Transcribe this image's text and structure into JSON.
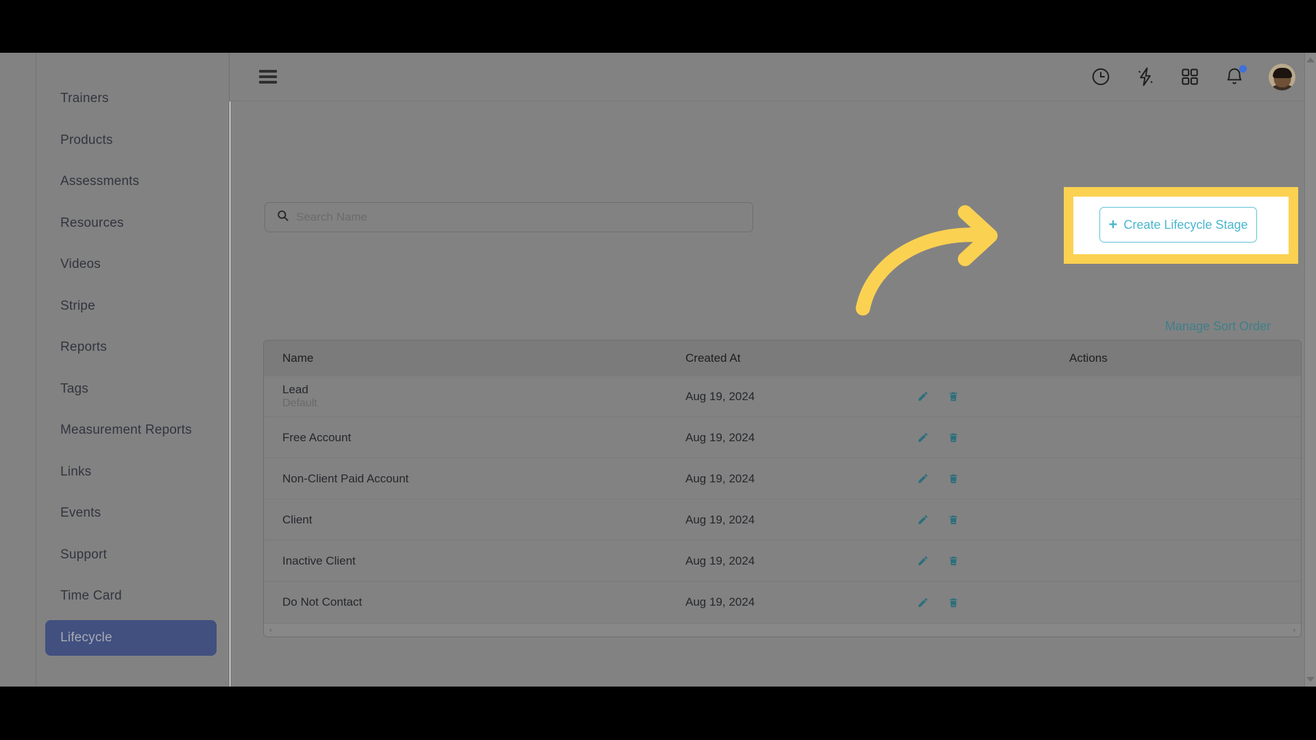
{
  "app": {
    "accent_teal": "#2b6f7c",
    "accent_cyan": "#49b6cd",
    "accent_indigo": "#41507f",
    "highlight_yellow": "#fbd152",
    "badge_blue": "#3f6fd8"
  },
  "sidebar": {
    "items": [
      {
        "label": "Trainers",
        "active": false
      },
      {
        "label": "Products",
        "active": false
      },
      {
        "label": "Assessments",
        "active": false
      },
      {
        "label": "Resources",
        "active": false
      },
      {
        "label": "Videos",
        "active": false
      },
      {
        "label": "Stripe",
        "active": false
      },
      {
        "label": "Reports",
        "active": false
      },
      {
        "label": "Tags",
        "active": false
      },
      {
        "label": "Measurement Reports",
        "active": false
      },
      {
        "label": "Links",
        "active": false
      },
      {
        "label": "Events",
        "active": false
      },
      {
        "label": "Support",
        "active": false
      },
      {
        "label": "Time Card",
        "active": false
      },
      {
        "label": "Lifecycle",
        "active": true
      }
    ]
  },
  "topbar": {
    "menu_icon": "hamburger-icon",
    "icons": [
      {
        "name": "clock-icon"
      },
      {
        "name": "lightning-bolt-icon"
      },
      {
        "name": "apps-grid-icon"
      },
      {
        "name": "bell-icon",
        "badge": true
      }
    ],
    "avatar_alt": "user-avatar"
  },
  "search": {
    "icon": "search-icon",
    "value": "",
    "placeholder": "Search Name"
  },
  "actions": {
    "manage_sort_order": "Manage Sort Order",
    "create_button": {
      "plus": "+",
      "label": "Create Lifecycle Stage"
    }
  },
  "table": {
    "columns": [
      "Name",
      "Created At",
      "Actions"
    ],
    "rows": [
      {
        "name": "Lead",
        "sub": "Default",
        "created_at": "Aug 19, 2024"
      },
      {
        "name": "Free Account",
        "sub": "",
        "created_at": "Aug 19, 2024"
      },
      {
        "name": "Non-Client Paid Account",
        "sub": "",
        "created_at": "Aug 19, 2024"
      },
      {
        "name": "Client",
        "sub": "",
        "created_at": "Aug 19, 2024"
      },
      {
        "name": "Inactive Client",
        "sub": "",
        "created_at": "Aug 19, 2024"
      },
      {
        "name": "Do Not Contact",
        "sub": "",
        "created_at": "Aug 19, 2024"
      }
    ],
    "row_action_icons": [
      "edit-pencil-icon",
      "delete-trash-icon"
    ],
    "hscroll": {
      "left_arrow": "‹",
      "right_arrow": "›"
    }
  },
  "annotation": {
    "arrow": "curved-arrow-right",
    "target": "create-lifecycle-stage-button"
  }
}
